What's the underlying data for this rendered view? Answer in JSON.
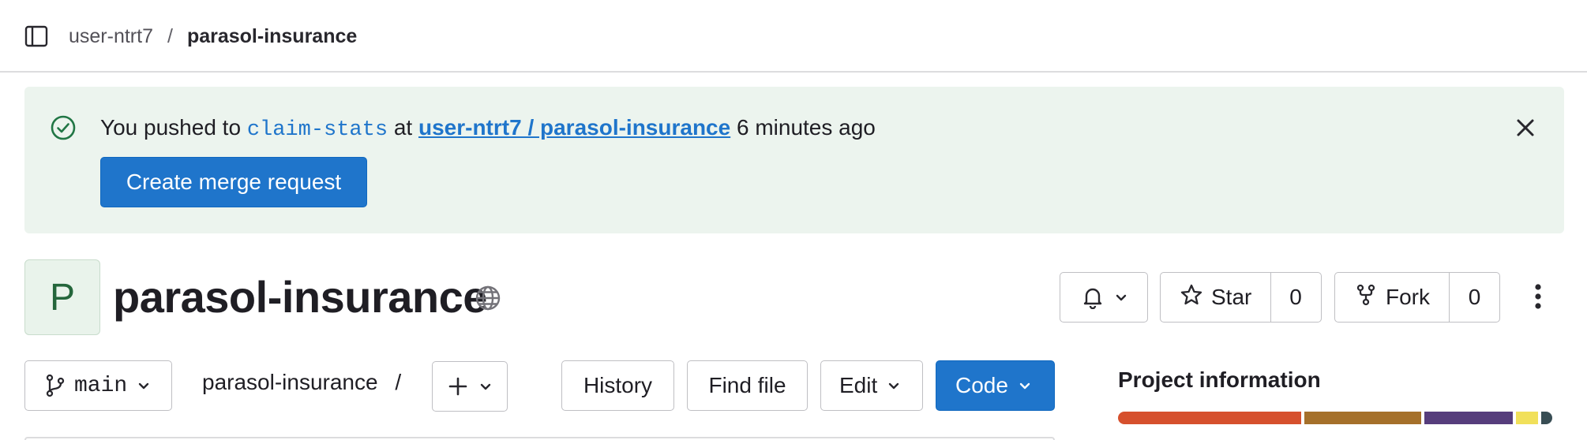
{
  "breadcrumb": {
    "namespace": "user-ntrt7",
    "separator": "/",
    "project": "parasol-insurance"
  },
  "alert": {
    "prefix": "You pushed to ",
    "branch": "claim-stats",
    "middle": " at ",
    "project_link": "user-ntrt7 / parasol-insurance",
    "suffix": " 6 minutes ago",
    "button_label": "Create merge request",
    "icon": "check-circle-icon",
    "close_icon": "close-icon"
  },
  "project": {
    "avatar_letter": "P",
    "name": "parasol-insurance",
    "visibility_icon": "globe-icon"
  },
  "actions": {
    "notification_icon": "bell-icon",
    "star_label": "Star",
    "star_count": "0",
    "fork_label": "Fork",
    "fork_count": "0",
    "more_icon": "kebab-icon"
  },
  "repo_toolbar": {
    "branch": "main",
    "path": "parasol-insurance",
    "path_separator": "/",
    "history_label": "History",
    "find_file_label": "Find file",
    "edit_label": "Edit",
    "code_label": "Code"
  },
  "project_info": {
    "title": "Project information",
    "languages": [
      {
        "color": "#d6502d",
        "share": 0.33
      },
      {
        "color": "#a5702a",
        "share": 0.21
      },
      {
        "color": "#563d7c",
        "share": 0.16
      },
      {
        "color": "#f1e05a",
        "share": 0.04
      },
      {
        "color": "#384d54",
        "share": 0.02
      }
    ]
  },
  "colors": {
    "accent": "#1f75cb",
    "alert_bg": "#ecf4ee",
    "success": "#217645"
  }
}
